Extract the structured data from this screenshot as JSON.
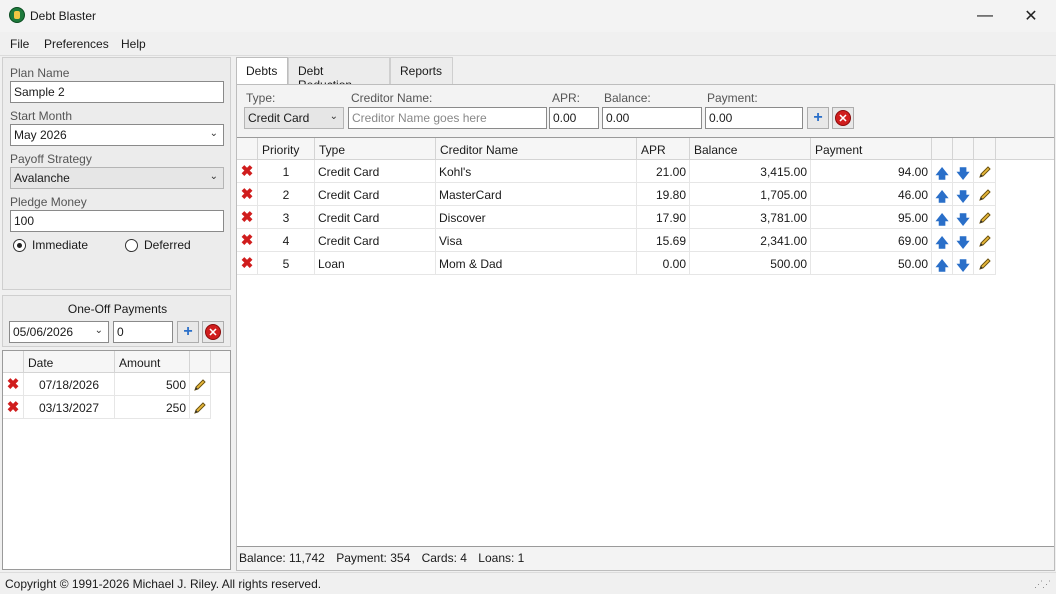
{
  "window": {
    "title": "Debt Blaster",
    "min_glyph": "—",
    "max_glyph": "☐",
    "close_glyph": "✕"
  },
  "menu": [
    "File",
    "Preferences",
    "Help"
  ],
  "plan": {
    "plan_name_label": "Plan Name",
    "plan_name_value": "Sample 2",
    "start_month_label": "Start Month",
    "start_month_value": "May 2026",
    "payoff_strategy_label": "Payoff Strategy",
    "payoff_strategy_value": "Avalanche",
    "pledge_money_label": "Pledge Money",
    "pledge_money_value": "100",
    "radio_immediate": "Immediate",
    "radio_deferred": "Deferred",
    "selected": "Immediate"
  },
  "oneoff": {
    "title": "One-Off Payments",
    "date_value": "05/06/2026",
    "amount_value": "0",
    "columns": [
      "Date",
      "Amount"
    ],
    "rows": [
      {
        "date": "07/18/2026",
        "amount": "500"
      },
      {
        "date": "03/13/2027",
        "amount": "250"
      }
    ]
  },
  "tabs": [
    "Debts",
    "Debt Reduction",
    "Reports"
  ],
  "active_tab": "Debts",
  "entry": {
    "type_label": "Type:",
    "type_value": "Credit Card",
    "creditor_label": "Creditor Name:",
    "creditor_placeholder": "Creditor Name goes here",
    "apr_label": "APR:",
    "apr_value": "0.00",
    "balance_label": "Balance:",
    "balance_value": "0.00",
    "payment_label": "Payment:",
    "payment_value": "0.00"
  },
  "debts": {
    "columns": [
      "Priority",
      "Type",
      "Creditor Name",
      "APR",
      "Balance",
      "Payment"
    ],
    "rows": [
      {
        "priority": "1",
        "type": "Credit Card",
        "creditor": "Kohl's",
        "apr": "21.00",
        "balance": "3,415.00",
        "payment": "94.00"
      },
      {
        "priority": "2",
        "type": "Credit Card",
        "creditor": "MasterCard",
        "apr": "19.80",
        "balance": "1,705.00",
        "payment": "46.00"
      },
      {
        "priority": "3",
        "type": "Credit Card",
        "creditor": "Discover",
        "apr": "17.90",
        "balance": "3,781.00",
        "payment": "95.00"
      },
      {
        "priority": "4",
        "type": "Credit Card",
        "creditor": "Visa",
        "apr": "15.69",
        "balance": "2,341.00",
        "payment": "69.00"
      },
      {
        "priority": "5",
        "type": "Loan",
        "creditor": "Mom & Dad",
        "apr": "0.00",
        "balance": "500.00",
        "payment": "50.00"
      }
    ]
  },
  "summary": {
    "balance": "Balance: 11,742",
    "payment": "Payment: 354",
    "cards": "Cards: 4",
    "loans": "Loans: 1"
  },
  "footer": {
    "copyright": "Copyright © 1991-2026 Michael J. Riley. All rights reserved."
  },
  "colors": {
    "accent_blue": "#2a6fc9",
    "delete_red": "#d01d1d"
  },
  "icons": {
    "delete": "delete-x-icon",
    "up": "arrow-up-icon",
    "down": "arrow-down-icon",
    "edit": "pencil-icon",
    "add": "plus-icon",
    "remove": "remove-circle-icon"
  }
}
